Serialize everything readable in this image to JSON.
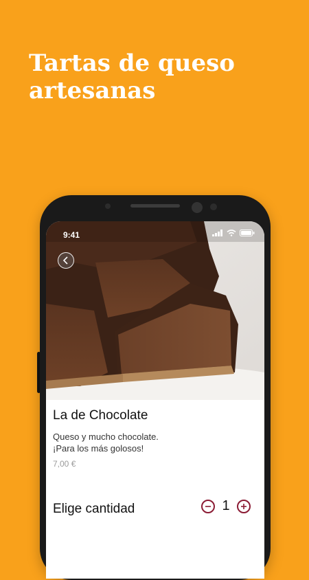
{
  "theme": {
    "background": "#f9a11b",
    "accent": "#8b1b34"
  },
  "promo": {
    "headline": "Tartas de queso artesanas"
  },
  "status_bar": {
    "time": "9:41"
  },
  "product": {
    "name": "La de Chocolate",
    "description_line1": "Queso y mucho chocolate.",
    "description_line2": "¡Para los más golosos!",
    "price": "7,00 €"
  },
  "quantity": {
    "label": "Elige cantidad",
    "value": "1"
  },
  "icons": {
    "back": "chevron-left-icon",
    "minus": "minus-circle-icon",
    "plus": "plus-circle-icon"
  }
}
